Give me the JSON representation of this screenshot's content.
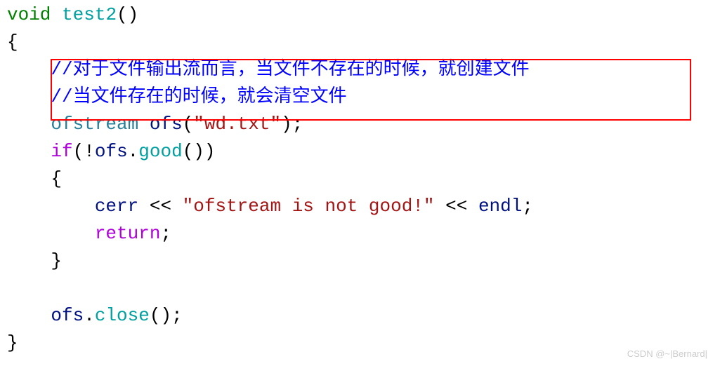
{
  "code": {
    "line1": {
      "void": "void",
      "func": "test2",
      "parens": "()"
    },
    "line2": {
      "brace": "{"
    },
    "comment1": "//对于文件输出流而言，当文件不存在的时候，就创建文件",
    "comment2": "//当文件存在的时候，就会清空文件",
    "line5": {
      "type": "ofstream",
      "id": "ofs",
      "paren_open": "(",
      "str": "\"wd.txt\"",
      "paren_close": ");"
    },
    "line6": {
      "if_kw": "if",
      "open": "(!",
      "id": "ofs",
      "dot": ".",
      "method": "good",
      "close": "())"
    },
    "line7": {
      "brace": "{"
    },
    "line8": {
      "cerr": "cerr",
      "op1": " << ",
      "str": "\"ofstream is not good!\"",
      "op2": " << ",
      "endl": "endl",
      "semi": ";"
    },
    "line9": {
      "ret": "return",
      "semi": ";"
    },
    "line10": {
      "brace": "}"
    },
    "line12": {
      "id": "ofs",
      "dot": ".",
      "method": "close",
      "close": "();"
    },
    "line13": {
      "brace": "}"
    }
  },
  "watermark": "CSDN @~|Bernard|"
}
